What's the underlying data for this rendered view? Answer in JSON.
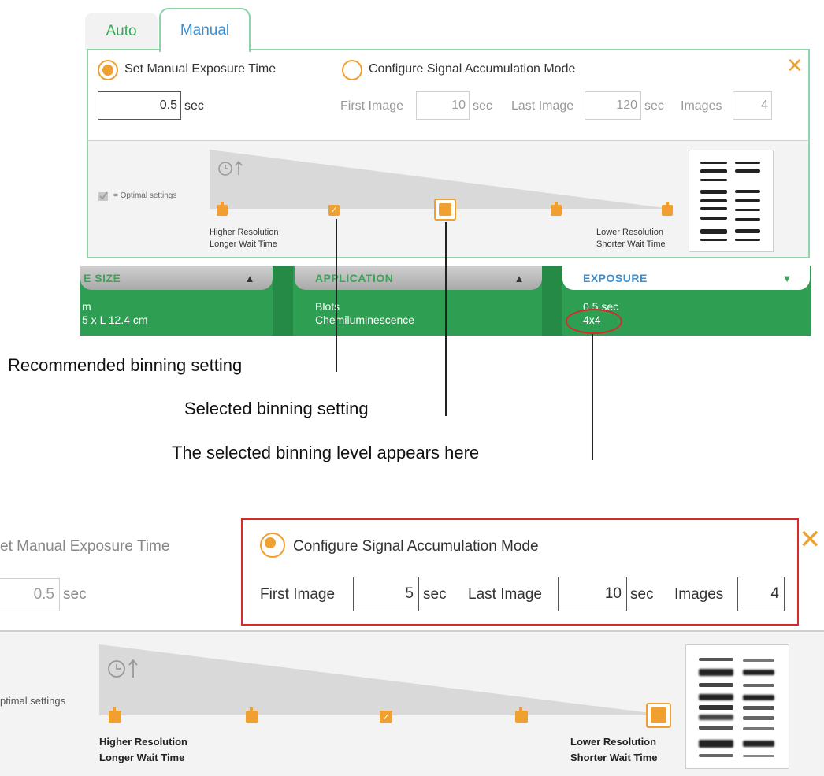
{
  "tabs": {
    "auto": "Auto",
    "manual": "Manual"
  },
  "manual": {
    "set_manual_label": "Set Manual Exposure Time",
    "exposure_value": "0.5",
    "sec": "sec",
    "configure_label": "Configure Signal Accumulation Mode",
    "first_image_label": "First Image",
    "first_image_value": "10",
    "last_image_label": "Last Image",
    "last_image_value": "120",
    "images_label": "Images",
    "images_value": "4",
    "optimal_settings": "= Optimal settings",
    "higher_res": "Higher Resolution",
    "longer_wait": "Longer Wait Time",
    "lower_res": "Lower Resolution",
    "shorter_wait": "Shorter Wait Time",
    "selected_stop": 3,
    "recommended_stop": 2
  },
  "bottom_bar": {
    "size_tab": "E SIZE",
    "size_line1": "m",
    "size_line2": "5 x L 12.4 cm",
    "application_tab": "APPLICATION",
    "application_line1": "Blots",
    "application_line2": "Chemiluminescence",
    "exposure_tab": "EXPOSURE",
    "exposure_line1": "0.5 sec",
    "exposure_line2": "4x4"
  },
  "callouts": {
    "recommended": "Recommended binning setting",
    "selected": "Selected binning setting",
    "level_here": "The selected binning level appears here"
  },
  "zoom": {
    "set_manual_label": "et Manual Exposure Time",
    "exposure_value": "0.5",
    "sec": "sec",
    "configure_label": "Configure Signal Accumulation Mode",
    "first_image_label": "First Image",
    "first_image_value": "5",
    "last_image_label": "Last Image",
    "last_image_value": "10",
    "images_label": "Images",
    "images_value": "4",
    "optimal_settings": "ptimal settings",
    "higher_res": "Higher Resolution",
    "longer_wait": "Longer Wait Time",
    "lower_res": "Lower Resolution",
    "shorter_wait": "Shorter Wait Time",
    "selected_stop": 5,
    "recommended_stop": 3
  },
  "colors": {
    "accent": "#f0a030",
    "green": "#2e9e52",
    "highlight": "#d62a2a",
    "tab_blue": "#3a8fd0"
  },
  "icons": {
    "clock": "clock-up-icon",
    "close": "close-icon",
    "check": "check-icon"
  }
}
